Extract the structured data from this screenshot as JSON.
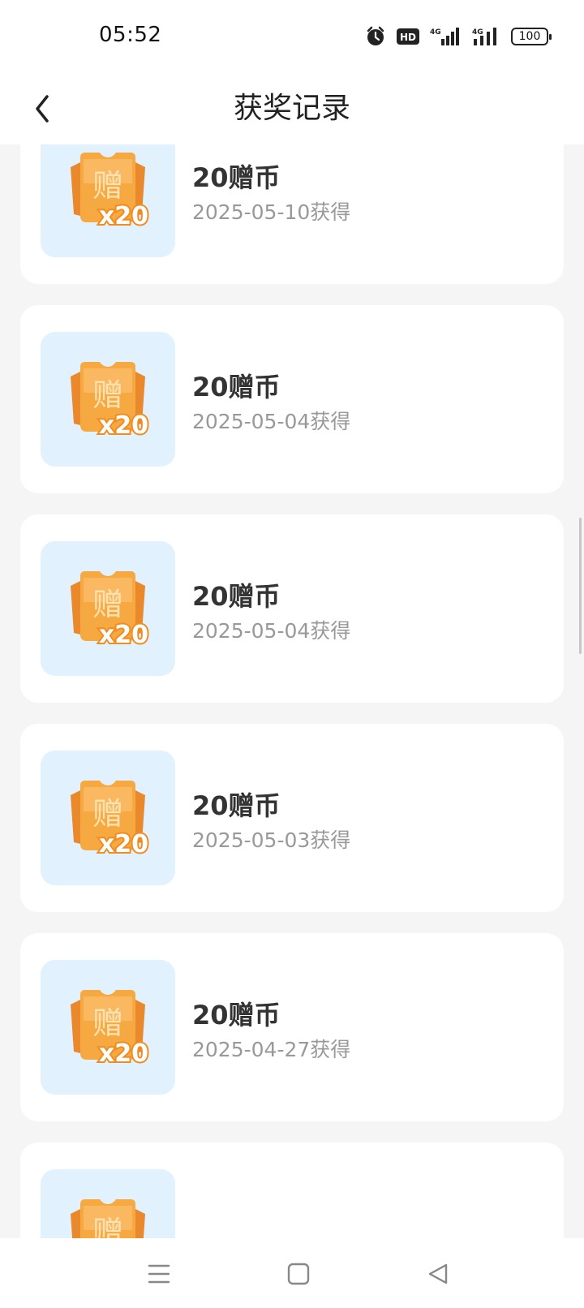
{
  "status_bar": {
    "time": "05:52",
    "icons": [
      "alarm-icon",
      "hd-icon",
      "signal-4g-icon",
      "signal-4g-icon"
    ],
    "battery": "100"
  },
  "header": {
    "title": "获奖记录",
    "back_icon": "chevron-left-icon"
  },
  "prize_thumbnail": {
    "glyph": "赠",
    "multiplier": "x20",
    "bg_color": "#e1f1fd",
    "coin_color": "#f7a941"
  },
  "records": [
    {
      "name": "20赠币",
      "date": "2025-05-10获得"
    },
    {
      "name": "20赠币",
      "date": "2025-05-04获得"
    },
    {
      "name": "20赠币",
      "date": "2025-05-04获得"
    },
    {
      "name": "20赠币",
      "date": "2025-05-03获得"
    },
    {
      "name": "20赠币",
      "date": "2025-04-27获得"
    },
    {
      "name": "",
      "date": ""
    }
  ],
  "nav_bar": {
    "icons": [
      "menu-icon",
      "home-icon",
      "back-triangle-icon"
    ]
  }
}
